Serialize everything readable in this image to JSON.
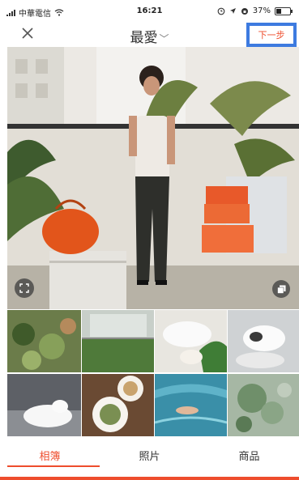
{
  "status_bar": {
    "carrier": "中華電信",
    "time": "16:21",
    "battery": "37%",
    "battery_level": 0.37
  },
  "header": {
    "title": "最愛",
    "next_label": "下一步"
  },
  "tabs": [
    {
      "label": "相簿",
      "active": true
    },
    {
      "label": "照片",
      "active": false
    },
    {
      "label": "商品",
      "active": false
    }
  ],
  "colors": {
    "accent": "#ee4d2d",
    "highlight": "#3d7be0"
  },
  "icons": {
    "close": "close-icon",
    "title_dropdown": "chevron-down-icon",
    "expand": "expand-icon",
    "multi_select": "multi-select-icon"
  }
}
